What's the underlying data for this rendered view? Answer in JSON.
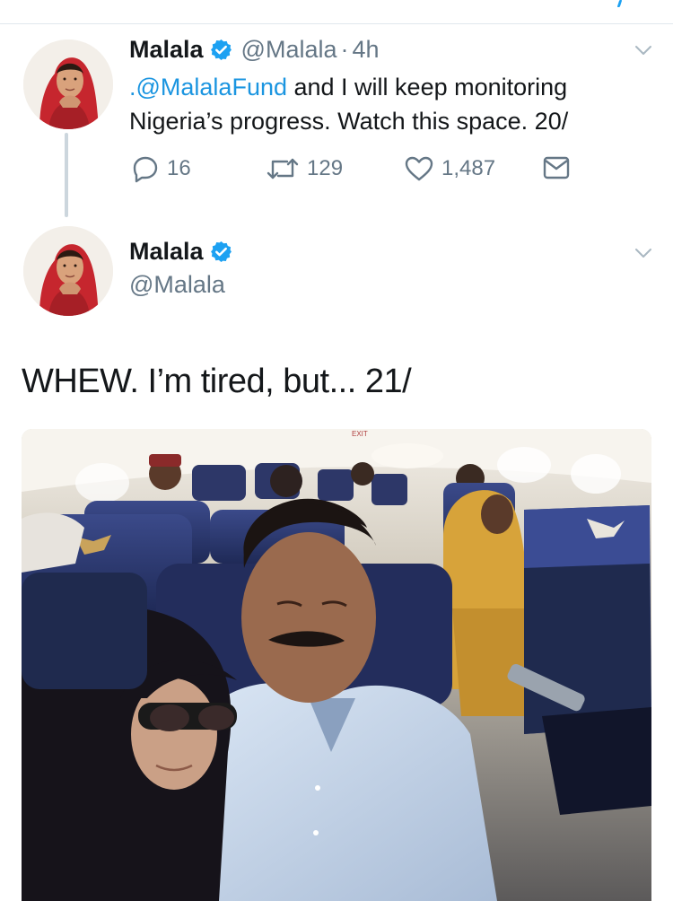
{
  "tweets": [
    {
      "name": "Malala",
      "handle": "@Malala",
      "separator": "·",
      "time": "4h",
      "text_mention": ".@MalalaFund",
      "text_rest": " and I will keep monitoring Nigeria’s progress. Watch this space. 20/",
      "reply_count": "16",
      "retweet_count": "129",
      "like_count": "1,487"
    },
    {
      "name": "Malala",
      "handle": "@Malala",
      "text": "WHEW. I’m tired, but... 21/",
      "image": {
        "exit_sign": "EXIT"
      }
    }
  ],
  "colors": {
    "verified": "#1da1f2",
    "link": "#1b95e0",
    "muted": "#657786",
    "thread_line": "#ccd6dd"
  },
  "icons": {
    "reply": "reply-icon",
    "retweet": "retweet-icon",
    "like": "heart-icon",
    "dm": "envelope-icon",
    "verified": "verified-badge-icon",
    "caret": "chevron-down-icon"
  }
}
